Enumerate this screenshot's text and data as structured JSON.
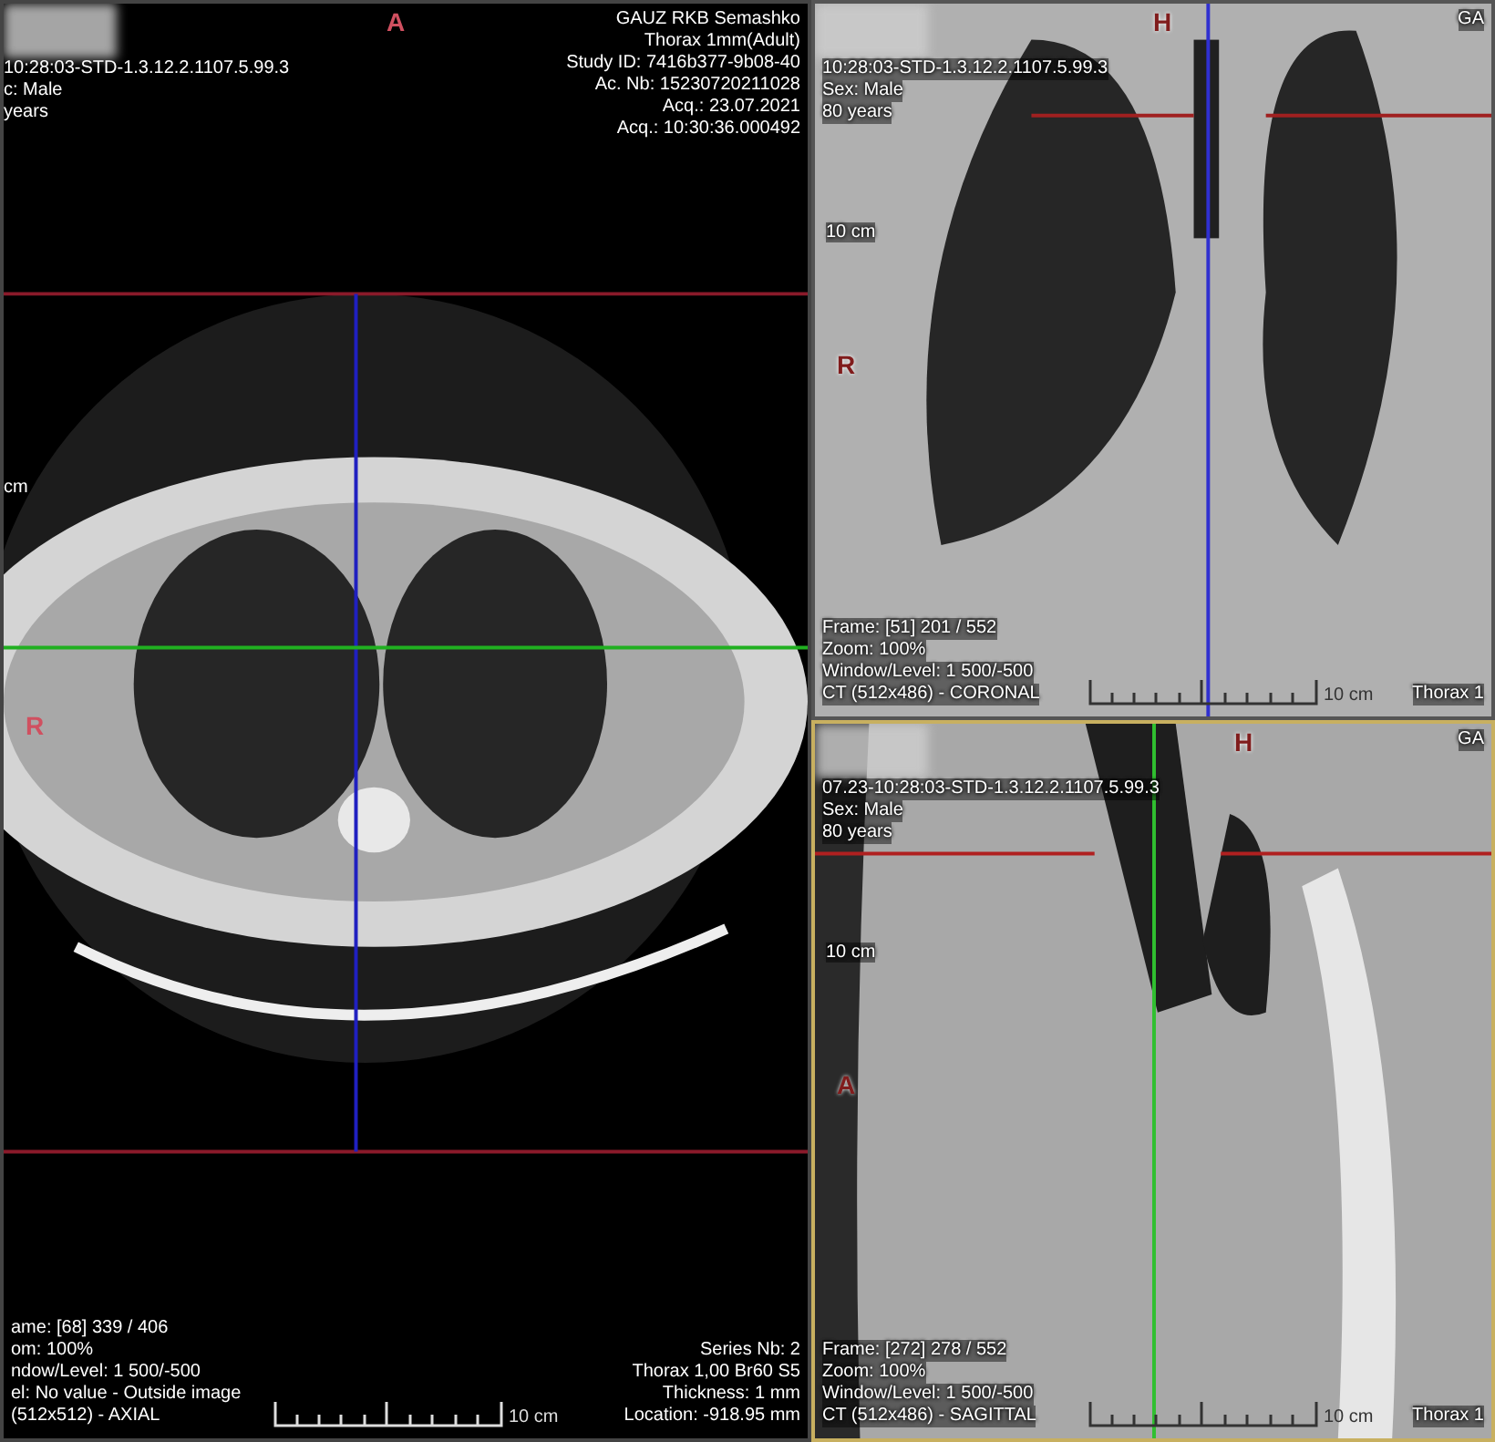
{
  "viewports": [
    {
      "kind": "axial",
      "selected": false,
      "orientation_top": "A",
      "orientation_side": "R",
      "scale_side": "cm",
      "scale_label": "10 cm",
      "top_left": [
        "10:28:03-STD-1.3.12.2.1107.5.99.3",
        "c: Male",
        "years"
      ],
      "top_right": [
        "GAUZ RKB Semashko",
        "Thorax 1mm(Adult)",
        "Study ID: 7416b377-9b08-40",
        "Ac. Nb: 15230720211028",
        "Acq.: 23.07.2021",
        "Acq.: 10:30:36.000492"
      ],
      "bottom_left": [
        "ame: [68] 339 / 406",
        "om: 100%",
        "ndow/Level: 1 500/-500",
        "el: No value - Outside image",
        "(512x512) - AXIAL"
      ],
      "bottom_right": [
        "Series Nb: 2",
        "Thorax 1,00 Br60 S5",
        "Thickness: 1 mm",
        "Location: -918.95 mm"
      ]
    },
    {
      "kind": "coronal",
      "selected": false,
      "orientation_top": "H",
      "orientation_side": "R",
      "scale_side": "10 cm",
      "scale_label": "10 cm",
      "top_left": [
        "10:28:03-STD-1.3.12.2.1107.5.99.3",
        "Sex: Male",
        "80 years"
      ],
      "top_right": [
        "GA"
      ],
      "bottom_left": [
        "Frame: [51] 201 / 552",
        "Zoom: 100%",
        "Window/Level: 1 500/-500",
        "CT (512x486) - CORONAL"
      ],
      "bottom_right": [
        "Thorax 1"
      ]
    },
    {
      "kind": "sagittal",
      "selected": true,
      "orientation_top": "H",
      "orientation_side": "A",
      "scale_side": "10 cm",
      "scale_label": "10 cm",
      "top_left": [
        "07.23-10:28:03-STD-1.3.12.2.1107.5.99.3",
        "Sex: Male",
        "80 years"
      ],
      "top_right": [
        "GA"
      ],
      "bottom_left": [
        "Frame: [272] 278 / 552",
        "Zoom: 100%",
        "Window/Level: 1 500/-500",
        "CT (512x486) - SAGITTAL"
      ],
      "bottom_right": [
        "Thorax 1"
      ]
    }
  ]
}
